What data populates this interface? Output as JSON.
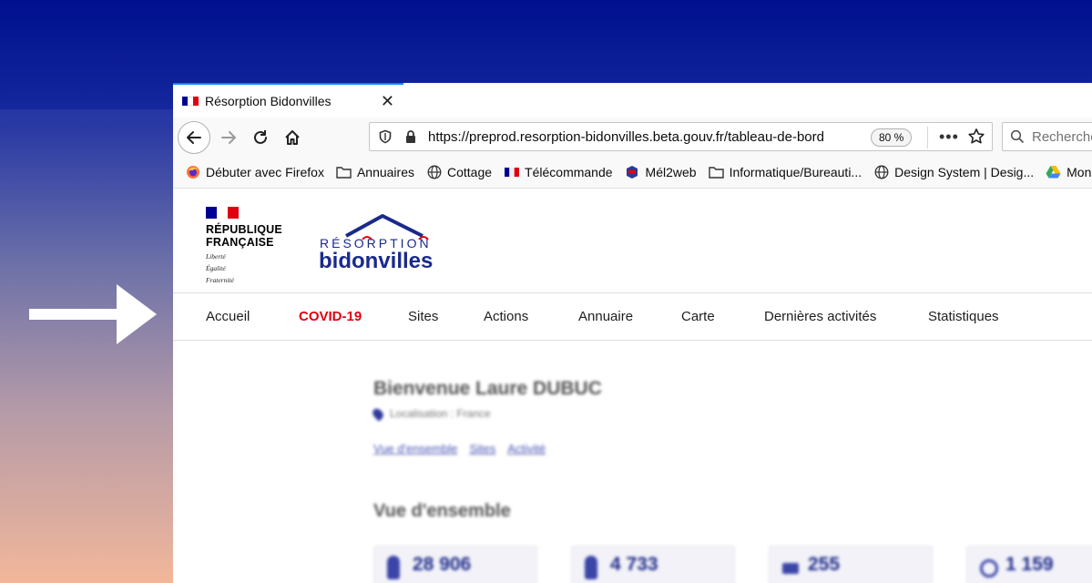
{
  "browser": {
    "tab": {
      "title": "Résorption Bidonvilles",
      "close_glyph": "✕"
    },
    "url": "https://preprod.resorption-bidonvilles.beta.gouv.fr/tableau-de-bord",
    "zoom": "80 %",
    "more_glyph": "•••",
    "search_placeholder": "Recherche",
    "bookmarks": [
      {
        "label": "Débuter avec Firefox",
        "icon": "firefox-icon"
      },
      {
        "label": "Annuaires",
        "icon": "folder-icon"
      },
      {
        "label": "Cottage",
        "icon": "globe-icon"
      },
      {
        "label": "Télécommande",
        "icon": "flag-icon"
      },
      {
        "label": "Mél2web",
        "icon": "mel-icon"
      },
      {
        "label": "Informatique/Bureauti...",
        "icon": "folder-icon"
      },
      {
        "label": "Design System | Desig...",
        "icon": "globe-icon"
      },
      {
        "label": "Mon Drive",
        "icon": "drive-icon"
      }
    ]
  },
  "site": {
    "rf_logo": {
      "line1": "RÉPUBLIQUE",
      "line2": "FRANÇAISE",
      "motto1": "Liberté",
      "motto2": "Égalité",
      "motto3": "Fraternité"
    },
    "brand": {
      "line1": "RÉSORPTION",
      "line2": "bidonvilles"
    },
    "menu": [
      "Accueil",
      "COVID-19",
      "Sites",
      "Actions",
      "Annuaire",
      "Carte",
      "Dernières activités",
      "Statistiques"
    ],
    "dashboard": {
      "welcome": "Bienvenue Laure DUBUC",
      "location": "Localisation : France",
      "subnav": [
        "Vue d'ensemble",
        "Sites",
        "Activité"
      ],
      "section_title": "Vue d'ensemble",
      "stats": [
        "28 906",
        "4 733",
        "255",
        "1 159"
      ]
    }
  },
  "colors": {
    "accent": "#0a84ff",
    "brand_blue": "#1a2a8a",
    "marianne_red": "#e1000f",
    "flag_blue": "#000091"
  }
}
